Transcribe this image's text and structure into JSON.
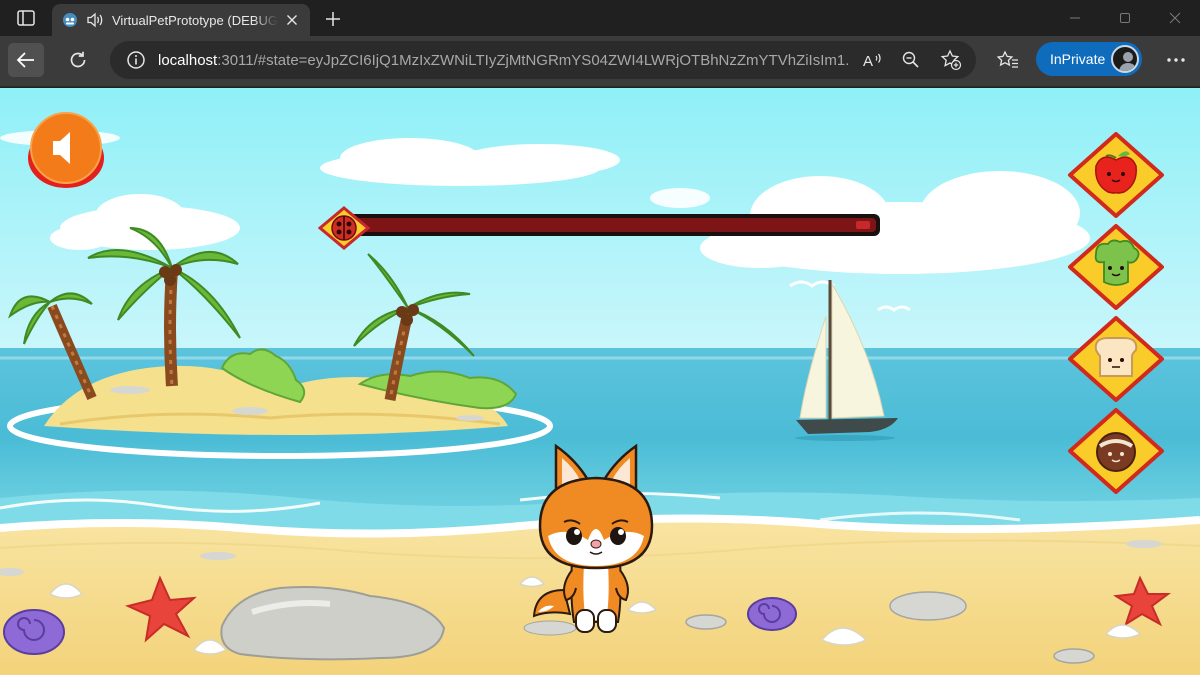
{
  "browser": {
    "tab_title": "VirtualPetPrototype (DEBUG)",
    "url_host": "localhost",
    "url_rest": ":3011/#state=eyJpZCI6IjQ1MzIxZWNiLTIyZjMtNGRmYS04ZWI4LWRjOTBhNzZmYTVhZiIsIm1...",
    "inprivate_label": "InPrivate",
    "icons": [
      "sidebar-icon",
      "tab-favicon",
      "speaker-icon",
      "close-icon",
      "plus-icon",
      "minimize-icon",
      "maximize-icon",
      "close-icon",
      "back-arrow-icon",
      "reload-icon",
      "info-icon",
      "read-aloud-icon",
      "zoom-out-icon",
      "add-favorite-icon",
      "favorites-icon",
      "more-icon"
    ]
  },
  "game": {
    "progress_level": 0.0,
    "controls": {
      "sound": "speaker-icon",
      "foods": [
        "apple",
        "broccoli",
        "bread",
        "coconut"
      ]
    },
    "colors": {
      "sky_top": "#8ff0f7",
      "sea": "#3eb6d3",
      "sand": "#f6dc8a",
      "button_orange": "#f47b1a",
      "food_diamond": "#f9cc29",
      "food_border": "#d12a1c",
      "progress_track": "#7d1416"
    }
  }
}
